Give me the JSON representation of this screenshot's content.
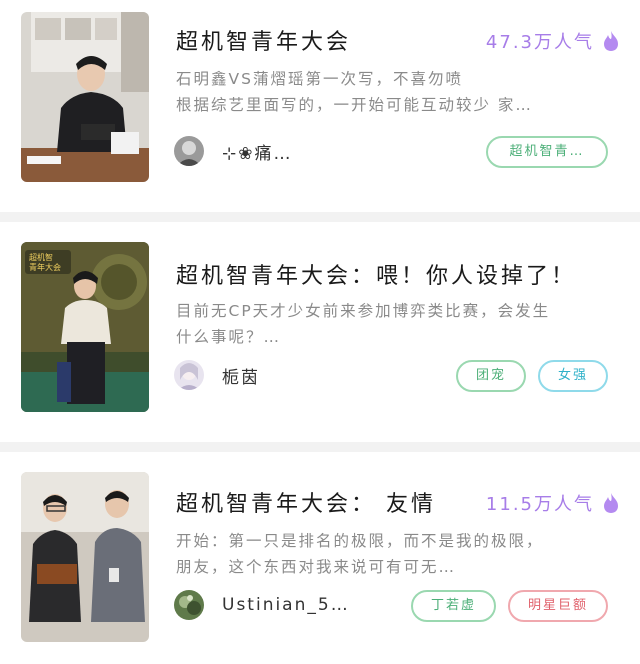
{
  "feed": {
    "cards": [
      {
        "title": "超机智青年大会",
        "heat": "47.3万人气",
        "desc_lines": [
          "石明鑫VS蒲熠瑶第一次写，不喜勿喷",
          "根据综艺里面写的，一开始可能互动较少 家…"
        ],
        "author": "⊹❀痛…",
        "tags": [
          "超机智青…"
        ]
      },
      {
        "title": "超机智青年大会：喂！你人设掉了！",
        "heat": "",
        "desc_lines": [
          "目前无CP天才少女前来参加博弈类比赛，会发生",
          "什么事呢？…"
        ],
        "author": "栀茵",
        "tags": [
          "团宠",
          "女强"
        ]
      },
      {
        "title": "超机智青年大会： 友情",
        "heat": "11.5万人气",
        "desc_lines": [
          "开始：第一只是排名的极限，而不是我的极限，",
          "朋友，这个东西对我来说可有可无…"
        ],
        "author": "Ustinian_5…",
        "tags": [
          "丁若虚",
          "明星巨额"
        ]
      }
    ]
  },
  "colors": {
    "heat": "#a77de8",
    "tag_green": "#4caf78",
    "tag_cyan": "#2fb1c9",
    "tag_red": "#e0606b",
    "separator": "#f2f2f2"
  },
  "icons": {
    "heat": "flame-icon"
  }
}
